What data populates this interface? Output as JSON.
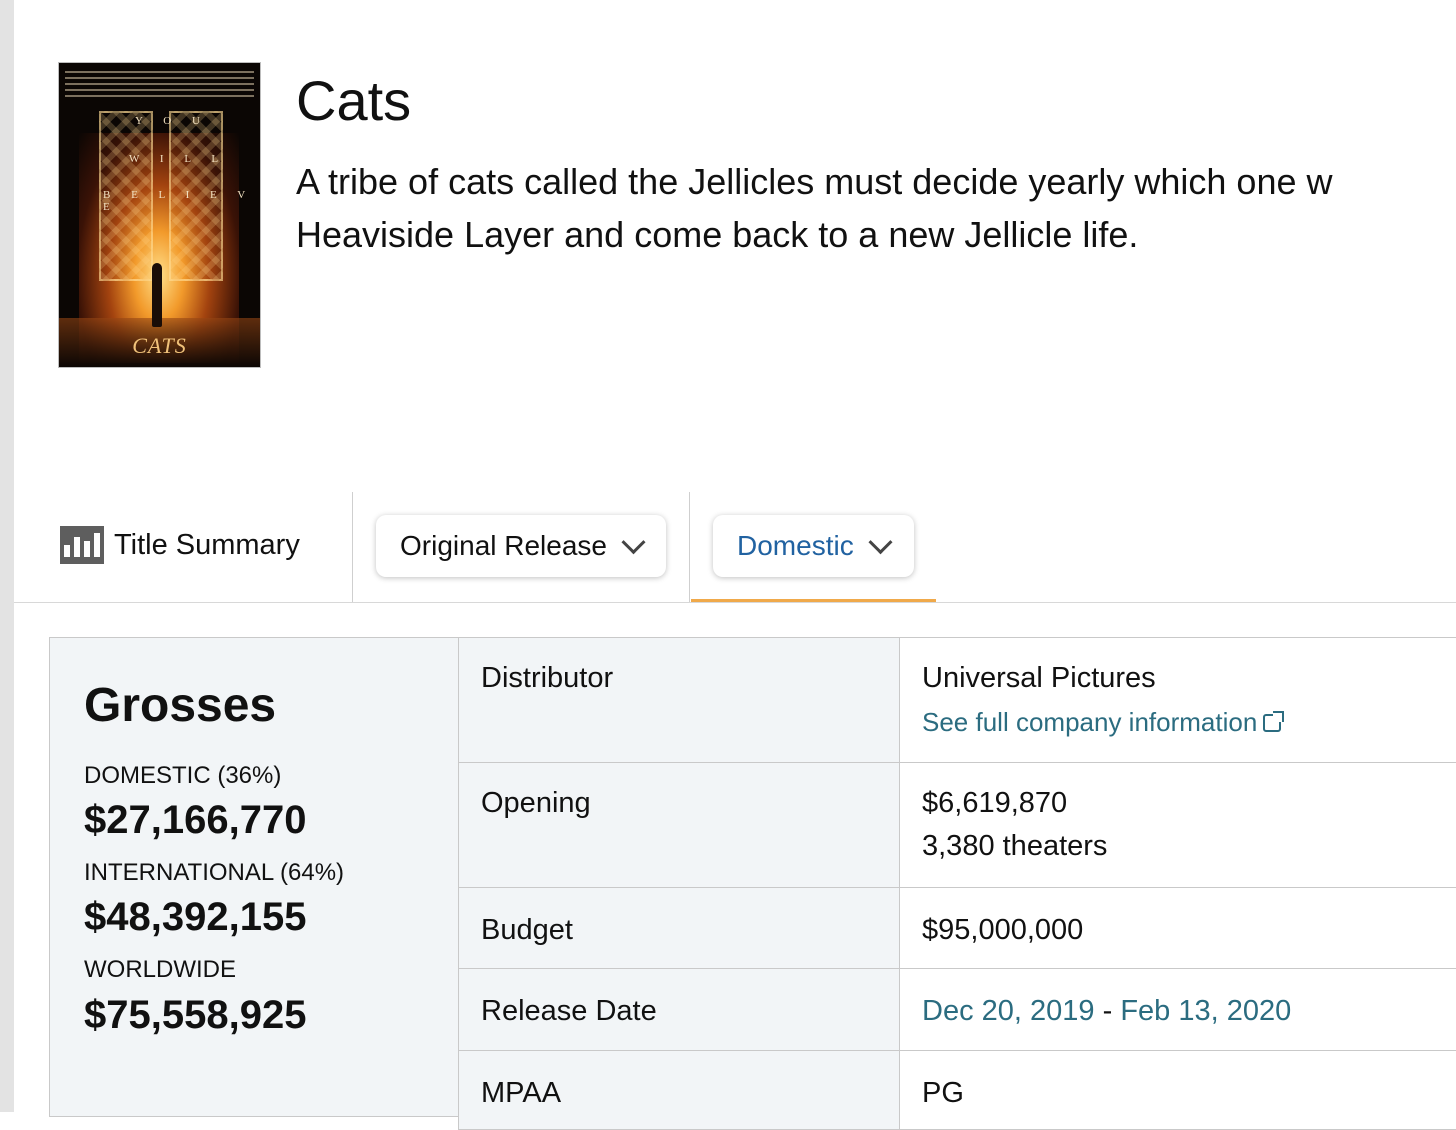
{
  "movie": {
    "title": "Cats",
    "synopsis_line1": "A tribe of cats called the Jellicles must decide yearly which one w",
    "synopsis_line2": "Heaviside Layer and come back to a new Jellicle life.",
    "poster": {
      "words": [
        "Y O U",
        "W I L L",
        "B E L I E V E"
      ],
      "logo": "CATS"
    }
  },
  "tabs": {
    "summary_label": "Title Summary",
    "release_dropdown": "Original Release",
    "region_dropdown": "Domestic"
  },
  "grosses": {
    "heading": "Grosses",
    "domestic_label": "DOMESTIC (36%)",
    "domestic_value": "$27,166,770",
    "international_label": "INTERNATIONAL (64%)",
    "international_value": "$48,392,155",
    "worldwide_label": "WORLDWIDE",
    "worldwide_value": "$75,558,925"
  },
  "details": {
    "distributor_label": "Distributor",
    "distributor_value": "Universal Pictures",
    "distributor_link": "See full company information",
    "opening_label": "Opening",
    "opening_value": "$6,619,870",
    "opening_theaters": "3,380 theaters",
    "budget_label": "Budget",
    "budget_value": "$95,000,000",
    "release_label": "Release Date",
    "release_start": "Dec 20, 2019",
    "release_sep": "-",
    "release_end": "Feb 13, 2020",
    "mpaa_label": "MPAA",
    "mpaa_value": "PG"
  },
  "colors": {
    "link": "#2b6c80",
    "dropdown_active": "#2162a1",
    "tab_underline": "#f0a94a",
    "panel_bg": "#f2f5f7"
  }
}
